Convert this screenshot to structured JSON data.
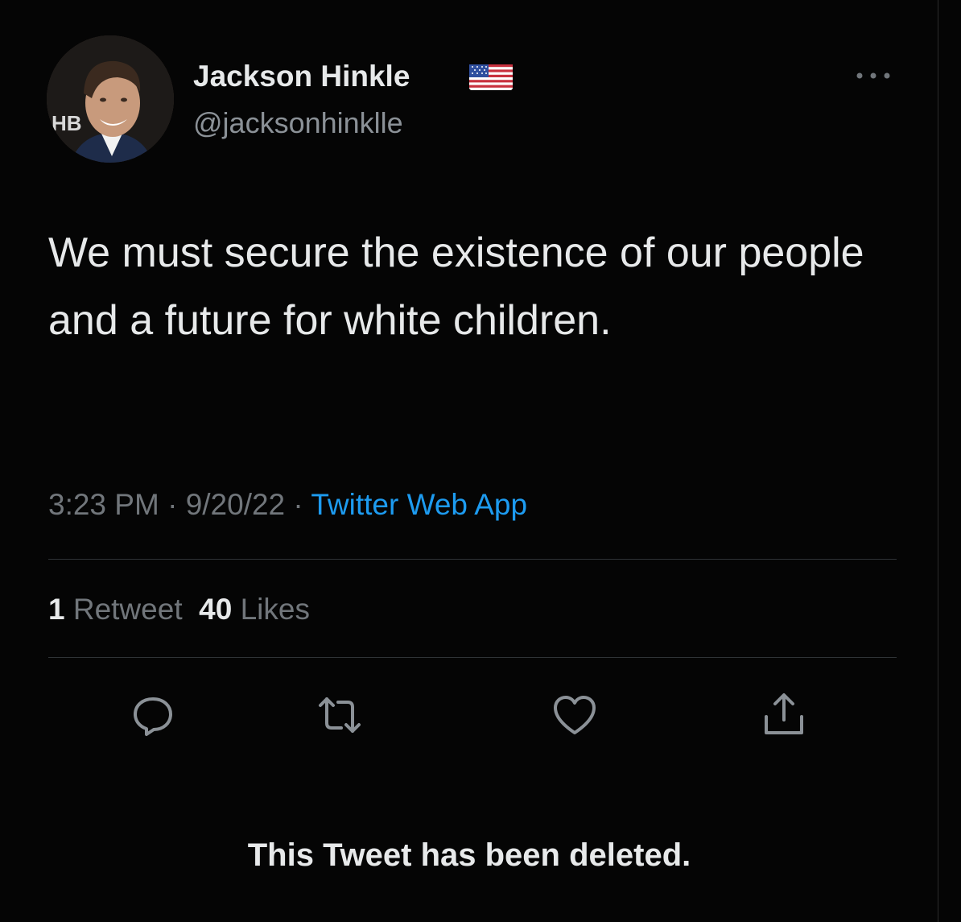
{
  "user": {
    "display_name": "Jackson Hinkle",
    "handle": "@jacksonhinklle",
    "avatar_icon": "profile-photo",
    "verified_flag_icon": "us-flag-emoji",
    "avatar_backdrop_text": "HB"
  },
  "tweet": {
    "text": "We must secure the existence of our people and a future for white children."
  },
  "meta": {
    "time": "3:23 PM",
    "sep1": " · ",
    "date": "9/20/22",
    "sep2": " · ",
    "source": "Twitter Web App"
  },
  "stats": {
    "retweets_count": "1",
    "retweets_label": "Retweet",
    "likes_count": "40",
    "likes_label": "Likes"
  },
  "actions": {
    "reply_icon": "reply-icon",
    "retweet_icon": "retweet-icon",
    "like_icon": "heart-icon",
    "share_icon": "share-icon"
  },
  "notice": {
    "deleted_text": "This Tweet has been deleted."
  },
  "colors": {
    "background": "#000000",
    "primary_text": "#e7e9ea",
    "secondary_text": "#71767b",
    "link": "#1d9bf0",
    "divider": "#2f3336"
  }
}
